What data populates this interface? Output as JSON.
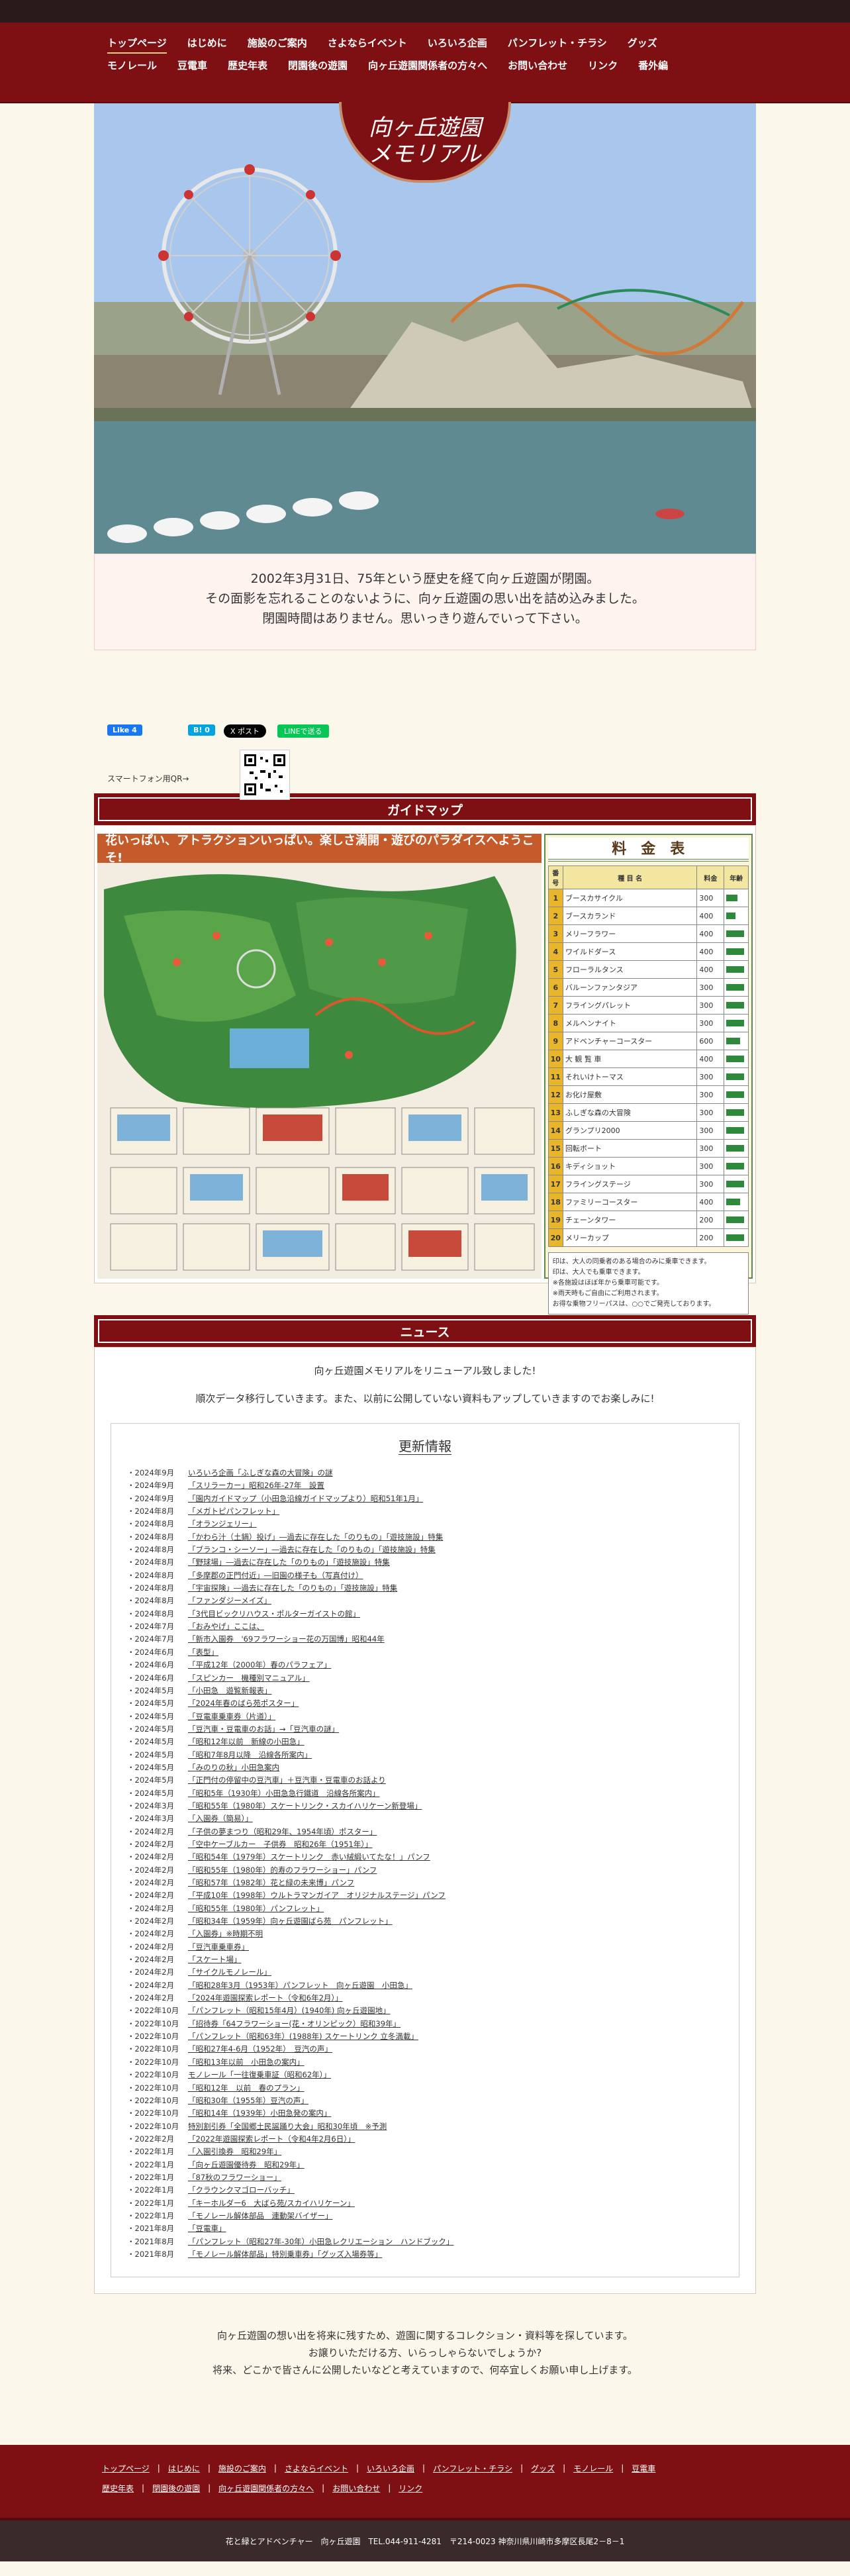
{
  "nav": {
    "row1": [
      "トップページ",
      "はじめに",
      "施設のご案内",
      "さよならイベント",
      "いろいろ企画",
      "パンフレット・チラシ",
      "グッズ"
    ],
    "row2": [
      "モノレール",
      "豆電車",
      "歴史年表",
      "閉園後の遊園",
      "向ヶ丘遊園関係者の方々へ",
      "お問い合わせ",
      "リンク",
      "番外編"
    ]
  },
  "logo": {
    "line1": "向ヶ丘遊園",
    "line2": "メモリアル"
  },
  "intro": [
    "2002年3月31日、75年という歴史を経て向ヶ丘遊園が閉園。",
    "その面影を忘れることのないように、向ヶ丘遊園の思い出を詰め込みました。",
    "閉園時間はありません。思いっきり遊んでいって下さい。"
  ],
  "social": {
    "like": "Like 4",
    "hatena": "B! 0",
    "x": "X ポスト",
    "line": "LINEで送る",
    "qr_label": "スマートフォン用QR→"
  },
  "guide": {
    "heading": "ガイドマップ",
    "map_banner": "花いっぱい、アトラクションいっぱい。楽しさ満開・遊びのパラダイスへようこそ!",
    "price_title": "料　金　表",
    "price_headers": [
      "番号",
      "種 目 名",
      "料金",
      "年齢"
    ],
    "rides": [
      {
        "num": "1",
        "name": "ブースカサイクル",
        "price": "300",
        "fill": 0.55
      },
      {
        "num": "2",
        "name": "ブースカランド",
        "price": "400",
        "fill": 0.45
      },
      {
        "num": "3",
        "name": "メリーフラワー",
        "price": "400",
        "fill": 0.9
      },
      {
        "num": "4",
        "name": "ワイルドダース",
        "price": "400",
        "fill": 0.9
      },
      {
        "num": "5",
        "name": "フローラルタンス",
        "price": "400",
        "fill": 0.9
      },
      {
        "num": "6",
        "name": "バルーンファンタジア",
        "price": "300",
        "fill": 0.9
      },
      {
        "num": "7",
        "name": "フライングパレット",
        "price": "300",
        "fill": 0.9
      },
      {
        "num": "8",
        "name": "メルヘンナイト",
        "price": "300",
        "fill": 0.9
      },
      {
        "num": "9",
        "name": "アドベンチャーコースター",
        "price": "600",
        "fill": 0.7
      },
      {
        "num": "10",
        "name": "大 観 覧 車",
        "price": "400",
        "fill": 0.9
      },
      {
        "num": "11",
        "name": "それいけトーマス",
        "price": "300",
        "fill": 0.9
      },
      {
        "num": "12",
        "name": "お化け屋敷",
        "price": "300",
        "fill": 0.9
      },
      {
        "num": "13",
        "name": "ふしぎな森の大冒険",
        "price": "300",
        "fill": 0.9
      },
      {
        "num": "14",
        "name": "グランプリ2000",
        "price": "300",
        "fill": 0.9
      },
      {
        "num": "15",
        "name": "回転ボート",
        "price": "300",
        "fill": 0.9
      },
      {
        "num": "16",
        "name": "キディショット",
        "price": "300",
        "fill": 0.9
      },
      {
        "num": "17",
        "name": "フライングステージ",
        "price": "300",
        "fill": 0.9
      },
      {
        "num": "18",
        "name": "ファミリーコースター",
        "price": "400",
        "fill": 0.7
      },
      {
        "num": "19",
        "name": "チェーンタワー",
        "price": "200",
        "fill": 0.9
      },
      {
        "num": "20",
        "name": "メリーカップ",
        "price": "200",
        "fill": 0.9
      }
    ],
    "price_notes": [
      "印は、大人の同乗者のある場合のみに乗車できます。",
      "印は、大人でも乗車できます。",
      "※各施設はほぼ年から乗車可能です。",
      "※雨天時もご自由にご利用されます。",
      "お得な乗物フリーパスは、○○でご発売しております。"
    ]
  },
  "news": {
    "heading": "ニュース",
    "msg1": "向ヶ丘遊園メモリアルをリニューアル致しました!",
    "msg2": "順次データ移行していきます。また、以前に公開していない資料もアップしていきますのでお楽しみに!",
    "list_title": "更新情報",
    "items": [
      {
        "date": "・2024年9月",
        "title": "いろいろ企画「ふしぎな森の大冒険」の謎"
      },
      {
        "date": "・2024年9月",
        "title": "「スリラーカー」昭和26年-27年　設置"
      },
      {
        "date": "・2024年9月",
        "title": "「園内ガイドマップ（小田急沿線ガイドマップより）昭和51年1月」"
      },
      {
        "date": "・2024年8月",
        "title": "「メガトピパンフレット」"
      },
      {
        "date": "・2024年8月",
        "title": "「オランジェリー」"
      },
      {
        "date": "・2024年8月",
        "title": "「かわら汁（土鍋）投げ」―過去に存在した「のりもの」「遊技施設」特集"
      },
      {
        "date": "・2024年8月",
        "title": "「ブランコ・シーソー」―過去に存在した「のりもの」「遊技施設」特集"
      },
      {
        "date": "・2024年8月",
        "title": "「野球場」―過去に存在した「のりもの」「遊技施設」特集"
      },
      {
        "date": "・2024年8月",
        "title": "「多摩郡の正門付近」―旧園の様子も（写真付け）"
      },
      {
        "date": "・2024年8月",
        "title": "「宇宙探険」―過去に存在した「のりもの」「遊技施設」特集"
      },
      {
        "date": "・2024年8月",
        "title": "「ファンダジーメイズ」"
      },
      {
        "date": "・2024年8月",
        "title": "「3代目ビックリハウス・ポルターガイストの館」"
      },
      {
        "date": "・2024年7月",
        "title": "「おみやげ」ここは、"
      },
      {
        "date": "・2024年7月",
        "title": "「新市入園券　'69フラワーショー花の万国博」昭和44年"
      },
      {
        "date": "・2024年6月",
        "title": "「表型」"
      },
      {
        "date": "・2024年6月",
        "title": "「平成12年（2000年）春のパラフェア」"
      },
      {
        "date": "・2024年6月",
        "title": "「スピンカー　機種別マニュアル」"
      },
      {
        "date": "・2024年5月",
        "title": "「小田急　遊覧新報表」"
      },
      {
        "date": "・2024年5月",
        "title": "「2024年春のばら苑ポスター」"
      },
      {
        "date": "・2024年5月",
        "title": "「豆電車乗車券（片道）」"
      },
      {
        "date": "・2024年5月",
        "title": "「豆汽車・豆電車のお話」→「豆汽車の謎」"
      },
      {
        "date": "・2024年5月",
        "title": "「昭和12年以前　新線の小田急」"
      },
      {
        "date": "・2024年5月",
        "title": "「昭和7年8月以降　沿線各所案内」"
      },
      {
        "date": "・2024年5月",
        "title": "「みのりの秋」小田急案内"
      },
      {
        "date": "・2024年5月",
        "title": "「正門付の停留中の豆汽車」＋豆汽車・豆電車のお話より"
      },
      {
        "date": "・2024年5月",
        "title": "「昭和5年（1930年）小田急急行鐵道　沿線各所案内」"
      },
      {
        "date": "・2024年3月",
        "title": "「昭和55年（1980年）スケートリンク・スカイハリケーン新登場」"
      },
      {
        "date": "・2024年3月",
        "title": "「入園券（簡易）」"
      },
      {
        "date": "・2024年2月",
        "title": "「子供の夢まつり（昭和29年、1954年頃）ポスター」"
      },
      {
        "date": "・2024年2月",
        "title": "「空中ケーブルカー　子供券　昭和26年（1951年）」"
      },
      {
        "date": "・2024年2月",
        "title": "「昭和54年（1979年）スケートリンク　赤い絨緞いてたな！」パンフ"
      },
      {
        "date": "・2024年2月",
        "title": "「昭和55年（1980年）的寿のフラワーショー」パンフ"
      },
      {
        "date": "・2024年2月",
        "title": "「昭和57年（1982年）花と緑の未来博」パンフ"
      },
      {
        "date": "・2024年2月",
        "title": "「平成10年（1998年）ウルトラマンガイア　オリジナルステージ」パンフ"
      },
      {
        "date": "・2024年2月",
        "title": "「昭和55年（1980年）パンフレット」"
      },
      {
        "date": "・2024年2月",
        "title": "「昭和34年（1959年）向ヶ丘遊園ばら苑　パンフレット」"
      },
      {
        "date": "・2024年2月",
        "title": "「入園券」※時期不明"
      },
      {
        "date": "・2024年2月",
        "title": "「豆汽車乗車券」"
      },
      {
        "date": "・2024年2月",
        "title": "「スケート場」"
      },
      {
        "date": "・2024年2月",
        "title": "「サイクルモノレール」"
      },
      {
        "date": "・2024年2月",
        "title": "「昭和28年3月（1953年）パンフレット　向ヶ丘遊園　小田急」"
      },
      {
        "date": "・2024年2月",
        "title": "「2024年遊園探索レポート（令和6年2月）」"
      },
      {
        "date": "・2022年10月",
        "title": "「パンフレット（昭和15年4月）(1940年) 向ヶ丘遊園地」"
      },
      {
        "date": "・2022年10月",
        "title": "「招待券「64フラワーショー(花・オリンピック）昭和39年」"
      },
      {
        "date": "・2022年10月",
        "title": "「パンフレット（昭和63年）(1988年) スケートリンク 立冬満載」"
      },
      {
        "date": "・2022年10月",
        "title": "「昭和27年4-6月（1952年）　豆汽の声」"
      },
      {
        "date": "・2022年10月",
        "title": "「昭和13年以前　小田急の案内」"
      },
      {
        "date": "・2022年10月",
        "title": "モノレール「一往復乗車証（昭和62年）」"
      },
      {
        "date": "・2022年10月",
        "title": "「昭和12年　以前　春のプラン」"
      },
      {
        "date": "・2022年10月",
        "title": "「昭和30年（1955年）豆汽の声」"
      },
      {
        "date": "・2022年10月",
        "title": "「昭和14年（1939年）小田急発の案内」"
      },
      {
        "date": "・2022年10月",
        "title": "特別割引券「全国郷土民謡踊り大会」昭和30年頃　※予測"
      },
      {
        "date": "・2022年2月",
        "title": "「2022年遊園探索レポート（令和4年2月6日）」"
      },
      {
        "date": "・2022年1月",
        "title": "「入園引換券　昭和29年」"
      },
      {
        "date": "・2022年1月",
        "title": "「向ヶ丘遊園優待券　昭和29年」"
      },
      {
        "date": "・2022年1月",
        "title": "「87秋のフラワーショー」"
      },
      {
        "date": "・2022年1月",
        "title": "「クラウンクマゴローバッチ」"
      },
      {
        "date": "・2022年1月",
        "title": "「キーホルダー6　大ばら苑/スカイハリケーン」"
      },
      {
        "date": "・2022年1月",
        "title": "「モノレール解体部品　連動架バイザー」"
      },
      {
        "date": "・2021年8月",
        "title": "「豆電車」"
      },
      {
        "date": "・2021年8月",
        "title": "「パンフレット（昭和27年-30年）小田急レクリエーション　ハンドブック」"
      },
      {
        "date": "・2021年8月",
        "title": "「モノレール解体部品」特別乗車券」「グッズ入場券等」"
      }
    ]
  },
  "closing": [
    "向ヶ丘遊園の想い出を将来に残すため、遊園に関するコレクション・資料等を探しています。",
    "お譲りいただける方、いらっしゃらないでしょうか?",
    "将来、どこかで皆さんに公開したいなどと考えていますので、何卒宜しくお願い申し上げます。"
  ],
  "footer": {
    "row1": [
      "トップページ",
      "はじめに",
      "施設のご案内",
      "さよならイベント",
      "いろいろ企画",
      "パンフレット・チラシ",
      "グッズ",
      "モノレール",
      "豆電車"
    ],
    "row2": [
      "歴史年表",
      "閉園後の遊園",
      "向ヶ丘遊園関係者の方々へ",
      "お問い合わせ",
      "リンク"
    ],
    "copyright": "花と緑とアドベンチャー　向ヶ丘遊園　TEL.044-911-4281　〒214-0023 神奈川県川崎市多摩区長尾2－8－1"
  },
  "colors": {
    "brand": "#7e0f12",
    "background": "#fbf7ea",
    "accent": "#f4d18a"
  }
}
